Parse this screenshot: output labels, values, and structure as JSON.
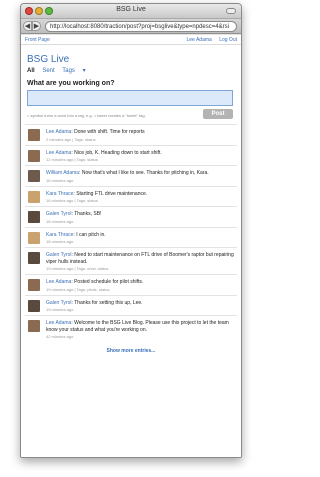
{
  "window": {
    "title": "BSG Live"
  },
  "browser": {
    "url": "http://localhost:8080/traction/post?proj=bsglive&type=npdesc=4&rsi"
  },
  "topnav": {
    "left": "Front Page",
    "user": "Lee Adama",
    "logout": "Log Out"
  },
  "app": {
    "title": "BSG Live",
    "filters": {
      "all": "All",
      "sent": "Sent",
      "tags": "Tags"
    },
    "prompt": "What are you working on?",
    "hint": "= symbol turns a word into a tag, e.g. = tweet creates a \"tweet\" tag.",
    "post_label": "Post",
    "show_more": "Show more entries..."
  },
  "entries": [
    {
      "author": "Lee Adama",
      "text": "Done with shift. Time for reports",
      "meta": "2 minutes ago | Tags: status",
      "avatar_color": "#8a6b52"
    },
    {
      "author": "Lee Adama",
      "text": "Nice job, K. Heading down to start shift.",
      "meta": "12 minutes ago | Tags: status",
      "avatar_color": "#8a6b52"
    },
    {
      "author": "William Adama",
      "text": "Now that's what I like to see. Thanks for pitching in, Kara.",
      "meta": "16 minutes ago",
      "avatar_color": "#6e5a4c"
    },
    {
      "author": "Kara Thrace",
      "text": "Starting FTL drive maintenance.",
      "meta": "18 minutes ago | Tags: status",
      "avatar_color": "#c9a26e"
    },
    {
      "author": "Galen Tyrol",
      "text": "Thanks, SB!",
      "meta": "18 minutes ago",
      "avatar_color": "#5a4a3e"
    },
    {
      "author": "Kara Thrace",
      "text": "I can pitch in.",
      "meta": "18 minutes ago",
      "avatar_color": "#c9a26e"
    },
    {
      "author": "Galen Tyrol",
      "text": "Need to start maintenance on FTL drive of Boomer's raptor but repairing viper hulls instead.",
      "meta": "19 minutes ago | Tags: crew, status",
      "avatar_color": "#5a4a3e"
    },
    {
      "author": "Lee Adama",
      "text": "Posted schedule for pilot shifts.",
      "meta": "19 minutes ago | Tags: pilots, status",
      "avatar_color": "#8a6b52"
    },
    {
      "author": "Galen Tyrol",
      "text": "Thanks for setting this up, Lee.",
      "meta": "19 minutes ago",
      "avatar_color": "#5a4a3e"
    },
    {
      "author": "Lee Adama",
      "text": "Welcome to the BSG Live Blog. Please use this project to let the team know your status and what you're working on.",
      "meta": "42 minutes ago",
      "avatar_color": "#8a6b52"
    }
  ]
}
